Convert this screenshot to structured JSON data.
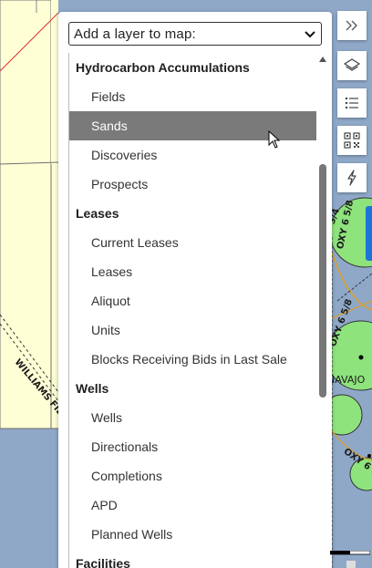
{
  "map": {
    "labels": {
      "williams_field": "WILLIAMS FIELD",
      "oxy_1": "OXY 6 5/8",
      "oxy_2": "OXY 6 5/8",
      "oxy_3": "OXY 6 5/8",
      "frag_34": "3/4",
      "navajo": "NAVAJO"
    },
    "colors": {
      "water": "#8fa8c8",
      "land": "#ffffd6",
      "green": "#8ee37d"
    }
  },
  "layer_select": {
    "label": "Add a layer to map:",
    "caret_icon": "chevron-down-icon"
  },
  "layer_list": {
    "groups": [
      {
        "label": "Hydrocarbon Accumulations",
        "items": [
          "Fields",
          "Sands",
          "Discoveries",
          "Prospects"
        ]
      },
      {
        "label": "Leases",
        "items": [
          "Current Leases",
          "Leases",
          "Aliquot",
          "Units",
          "Blocks Receiving Bids in Last Sale"
        ]
      },
      {
        "label": "Wells",
        "items": [
          "Wells",
          "Directionals",
          "Completions",
          "APD",
          "Planned Wells"
        ]
      },
      {
        "label": "Facilities",
        "items": []
      }
    ],
    "selected": "Sands",
    "selected_color": "#7a7a7a"
  },
  "toolbar": {
    "expand_icon": "double-chevron-right-icon",
    "layers_icon": "layers-icon",
    "list_icon": "list-icon",
    "qr_icon": "qr-code-icon",
    "lightning_icon": "lightning-icon"
  }
}
